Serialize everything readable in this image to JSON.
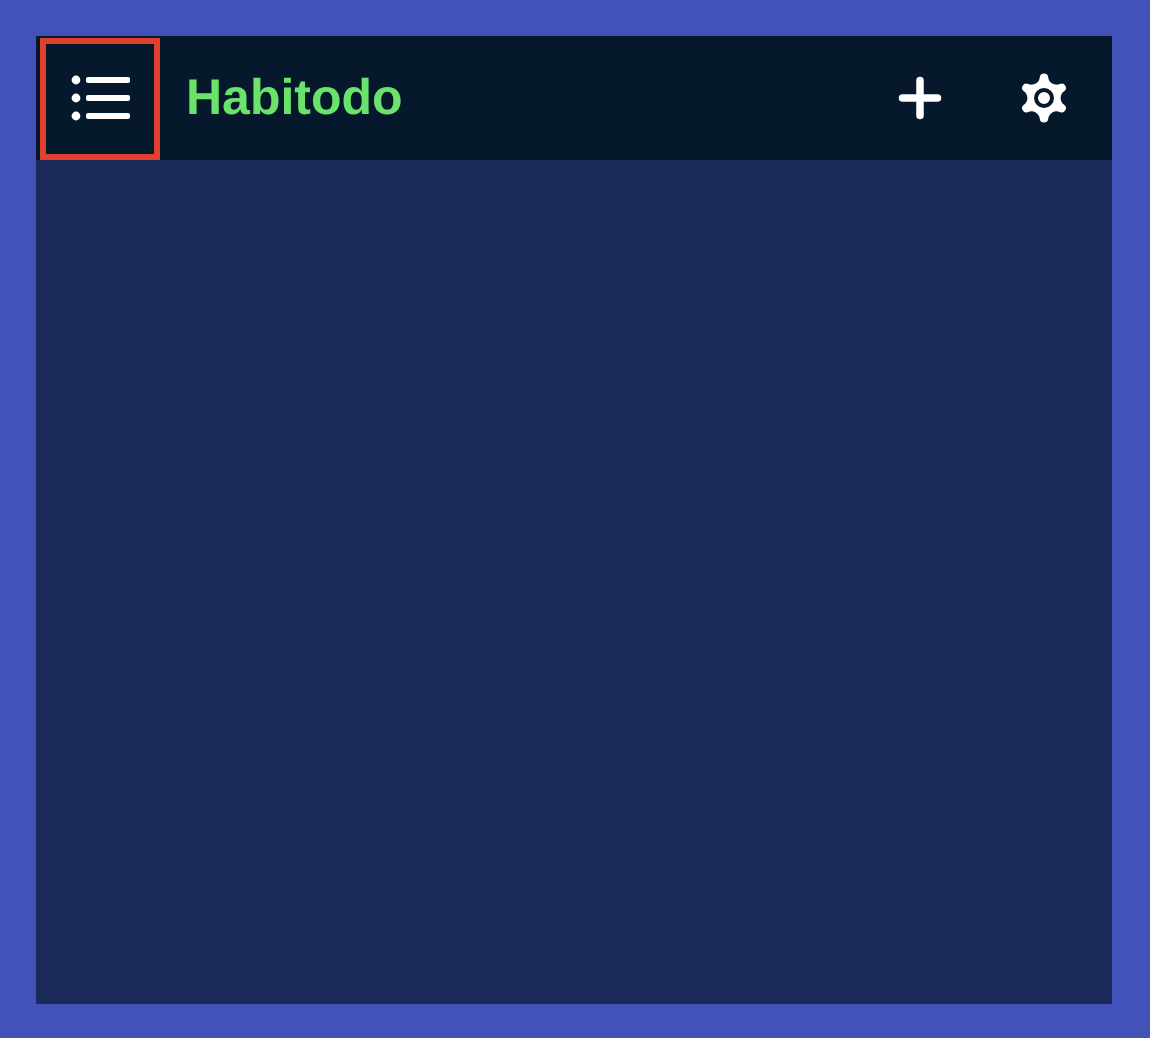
{
  "app_bar": {
    "menu_button": {
      "highlighted": true
    },
    "title": "Habitodo"
  }
}
